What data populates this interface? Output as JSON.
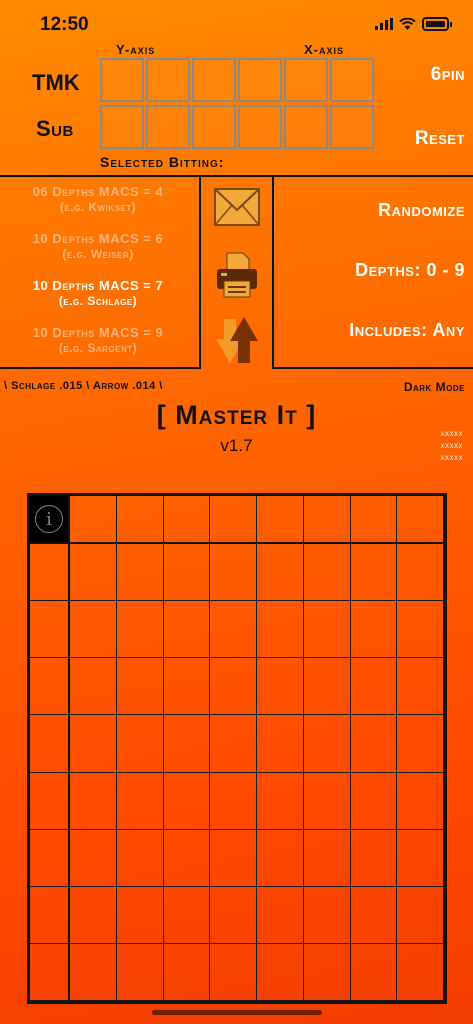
{
  "status_bar": {
    "time": "12:50"
  },
  "axes": {
    "y_label": "Y-axis",
    "x_label": "X-axis"
  },
  "rows": {
    "tmk_label": "TMK",
    "sub_label": "Sub"
  },
  "right_buttons": {
    "pins": "6pin",
    "reset": "Reset"
  },
  "selected_bitting_label": "Selected Bitting:",
  "macs_options": [
    {
      "main": "06 Depths MACS = 4",
      "sub": "(e.g. Kwikset)",
      "selected": false
    },
    {
      "main": "10 Depths MACS = 6",
      "sub": "(e.g. Weiser)",
      "selected": false
    },
    {
      "main": "10 Depths MACS = 7",
      "sub": "(e.g. Schlage)",
      "selected": true
    },
    {
      "main": "10 Depths MACS = 9",
      "sub": "(e.g. Sargent)",
      "selected": false
    }
  ],
  "icons": {
    "email": "envelope-icon",
    "print": "printer-icon",
    "swap": "swap-arrows-icon"
  },
  "settings": {
    "randomize": "Randomize",
    "depths": "Depths: 0 - 9",
    "includes": "Includes: Any"
  },
  "specs_text": "\\ Schlage .015 \\ Arrow .014 \\",
  "dark_mode_label": "Dark Mode",
  "app_title": "[ Master It ]",
  "version": "v1.7",
  "placeholders": [
    "xxxxx",
    "xxxxx",
    "xxxxx"
  ],
  "matrix": {
    "info_symbol": "i",
    "columns": 8,
    "rows": 8
  },
  "colors": {
    "accent_orange": "#ff6a00",
    "selected_text": "#ffffff",
    "dim_text": "#ffb27a"
  }
}
